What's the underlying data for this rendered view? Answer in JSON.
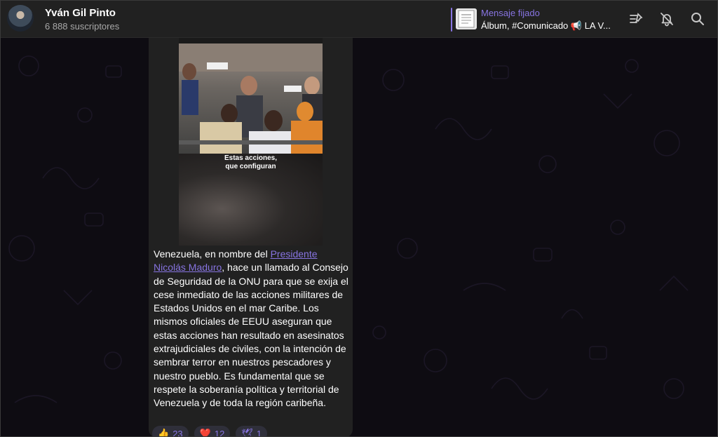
{
  "header": {
    "channel_name": "Yván Gil Pinto",
    "subscribers": "6 888 suscriptores",
    "pinned": {
      "title": "Mensaje fijado",
      "text": "Álbum, #Comunicado 📢 LA V..."
    },
    "icons": [
      "pinned-list-icon",
      "mute-bell-icon",
      "search-icon"
    ]
  },
  "message": {
    "video_caption_line1": "Estas acciones,",
    "video_caption_line2": "que configuran",
    "text_before": "Venezuela, en nombre del ",
    "link": "Presidente Nicolás Maduro",
    "text_after": ", hace un llamado al Consejo de Seguridad de la ONU para que se exija el cese inmediato de las acciones militares de Estados Unidos en el mar Caribe. Los mismos oficiales de EEUU aseguran que estas acciones han resultado en asesinatos extrajudiciales de civiles, con la intención de sembrar terror en nuestros pescadores y nuestro pueblo. Es fundamental que se respete la soberanía política y territorial de Venezuela y de toda la región caribeña.",
    "reactions": [
      {
        "emoji": "👍",
        "count": "23"
      },
      {
        "emoji": "❤️",
        "count": "12"
      },
      {
        "emoji": "🕊",
        "count": "1"
      }
    ]
  },
  "colors": {
    "accent": "#8774e1",
    "header_bg": "#212121",
    "bubble_bg": "#212121",
    "chat_bg": "#0e0c12"
  }
}
